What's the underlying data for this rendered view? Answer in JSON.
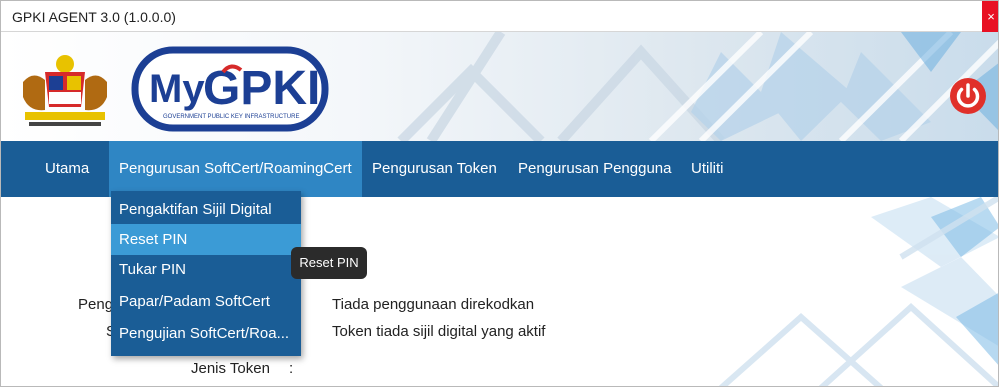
{
  "window": {
    "title": "GPKI AGENT 3.0 (1.0.0.0)",
    "close_glyph": "×"
  },
  "banner": {
    "logo_text": "MyGPKI",
    "logo_tagline": "GOVERNMENT PUBLIC KEY INFRASTRUCTURE",
    "crest_icon": "coat-of-arms-icon",
    "power_icon": "power-icon"
  },
  "menu": {
    "items": [
      {
        "label": "Utama"
      },
      {
        "label": "Pengurusan SoftCert/RoamingCert"
      },
      {
        "label": "Pengurusan Token"
      },
      {
        "label": "Pengurusan Pengguna"
      },
      {
        "label": "Utiliti"
      }
    ]
  },
  "dropdown": {
    "items": [
      {
        "label": "Pengaktifan Sijil Digital"
      },
      {
        "label": "Reset PIN"
      },
      {
        "label": "Tukar PIN"
      },
      {
        "label": "Papar/Padam SoftCert"
      },
      {
        "label": "Pengujian SoftCert/Roa..."
      }
    ]
  },
  "tooltip": {
    "text": "Reset PIN"
  },
  "content": {
    "row1_label_fragment": "Peng",
    "row1_value": "Tiada penggunaan direkodkan",
    "row2_label_fragment": "S",
    "row2_value": "Token tiada sijil digital yang aktif",
    "row3_label": "Jenis Token",
    "row3_colon": ":"
  },
  "colors": {
    "menubar": "#1a5d96",
    "menu_active": "#2f86c4",
    "dropdown_hover": "#3b9bd6",
    "close": "#e81123",
    "power": "#e0302a"
  }
}
